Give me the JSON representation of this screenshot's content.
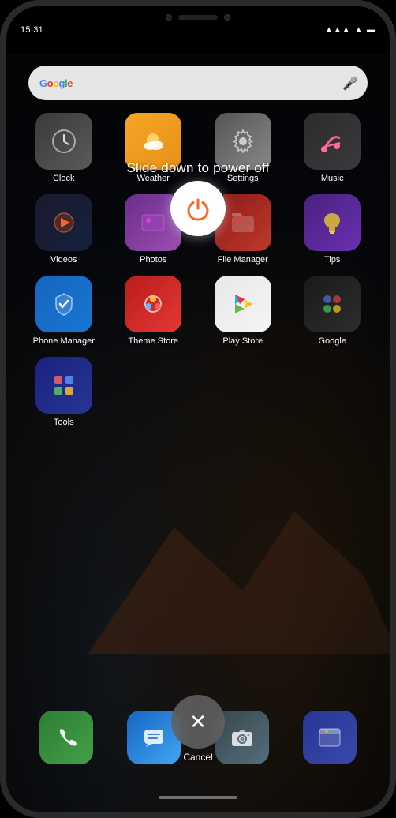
{
  "status": {
    "time": "15:31",
    "signal": "📶",
    "wifi": "▲",
    "battery": "▬"
  },
  "search": {
    "placeholder": "Google"
  },
  "powerOff": {
    "text": "Slide down to power off"
  },
  "apps": [
    {
      "id": "clock",
      "label": "Clock",
      "iconClass": "icon-clock",
      "emoji": "🕐"
    },
    {
      "id": "weather",
      "label": "Weather",
      "iconClass": "icon-weather",
      "emoji": "🌤"
    },
    {
      "id": "settings",
      "label": "Settings",
      "iconClass": "icon-settings",
      "emoji": "⚙️"
    },
    {
      "id": "music",
      "label": "Music",
      "iconClass": "icon-music",
      "emoji": "🎵"
    },
    {
      "id": "videos",
      "label": "Videos",
      "iconClass": "icon-videos",
      "emoji": "▶"
    },
    {
      "id": "photos",
      "label": "Photos",
      "iconClass": "icon-photos",
      "emoji": "🖼"
    },
    {
      "id": "filemanager",
      "label": "File Manager",
      "iconClass": "icon-filemanager",
      "emoji": "📁"
    },
    {
      "id": "tips",
      "label": "Tips",
      "iconClass": "icon-tips",
      "emoji": "💡"
    },
    {
      "id": "phonemanager",
      "label": "Phone Manager",
      "iconClass": "icon-phonemanager",
      "emoji": "🛡"
    },
    {
      "id": "themestore",
      "label": "Theme Store",
      "iconClass": "icon-themestore",
      "emoji": "🎨"
    },
    {
      "id": "playstore",
      "label": "Play Store",
      "iconClass": "icon-playstore",
      "emoji": "▶"
    },
    {
      "id": "google",
      "label": "Google",
      "iconClass": "icon-google",
      "emoji": "⬡"
    },
    {
      "id": "tools",
      "label": "Tools",
      "iconClass": "icon-tools",
      "emoji": "🔧"
    }
  ],
  "dock": [
    {
      "id": "phone",
      "iconClass": "dock-phone",
      "emoji": "📞"
    },
    {
      "id": "messages",
      "iconClass": "dock-messages",
      "emoji": "💬"
    },
    {
      "id": "camera",
      "iconClass": "dock-camera",
      "emoji": "📷"
    },
    {
      "id": "browser",
      "iconClass": "dock-browser",
      "emoji": "🌐"
    }
  ],
  "cancel": {
    "label": "Cancel",
    "symbol": "✕"
  }
}
